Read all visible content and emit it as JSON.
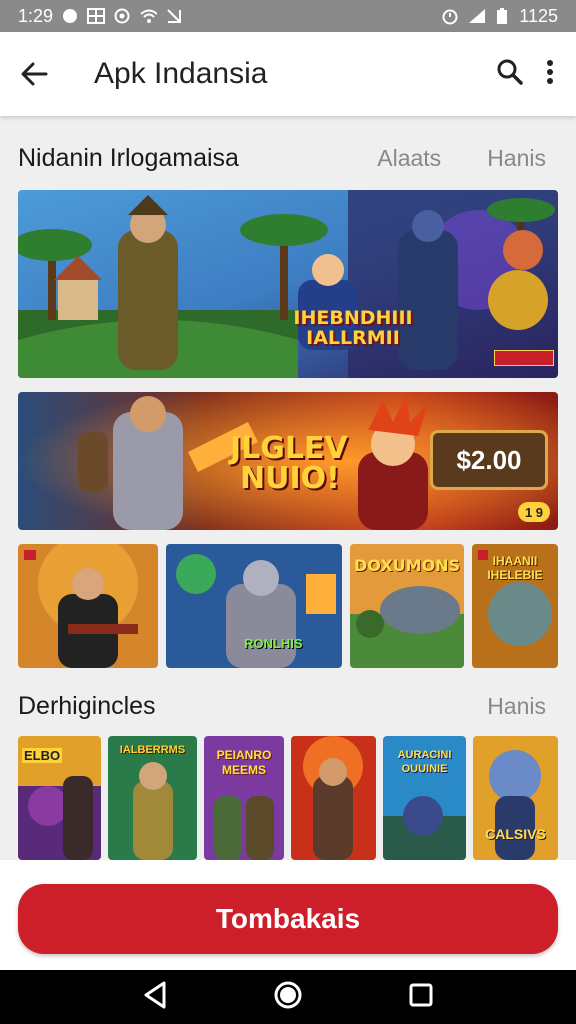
{
  "status_bar": {
    "time": "1:29",
    "clock_right": "1125"
  },
  "app_bar": {
    "title": "Apk Indansia"
  },
  "featured": {
    "title": "Nidanin Irlogamaisa",
    "links": [
      "Alaats",
      "Hanis"
    ]
  },
  "banners": [
    {
      "text_lines": [
        "IHEBNDHIII",
        "IALLRMII"
      ],
      "badge": ""
    },
    {
      "text_lines": [
        "JLGLEV",
        "NUIO!"
      ],
      "price": "$2.00",
      "badge": "1 9"
    }
  ],
  "featured_tiles": [
    {
      "label": ""
    },
    {
      "label": "RONLHIS"
    },
    {
      "label": "DOXUMONS"
    },
    {
      "label": "IHAANII IHELEBIE"
    }
  ],
  "second": {
    "title": "Derhigincles",
    "link": "Hanis"
  },
  "small_tiles": [
    {
      "label": "ELBO"
    },
    {
      "label": "IALBERRMS"
    },
    {
      "label": "PEIANRO MEEMS"
    },
    {
      "label": ""
    },
    {
      "label": "AURACINI OUUINIE"
    },
    {
      "label": "CALSIVS"
    }
  ],
  "cta": {
    "label": "Tombakais"
  },
  "colors": {
    "accent": "#cd1f2a",
    "status_bar": "#8a8a8a"
  },
  "icons": [
    "back-arrow-icon",
    "search-icon",
    "more-vert-icon",
    "nav-back-icon",
    "nav-home-icon",
    "nav-recents-icon"
  ]
}
